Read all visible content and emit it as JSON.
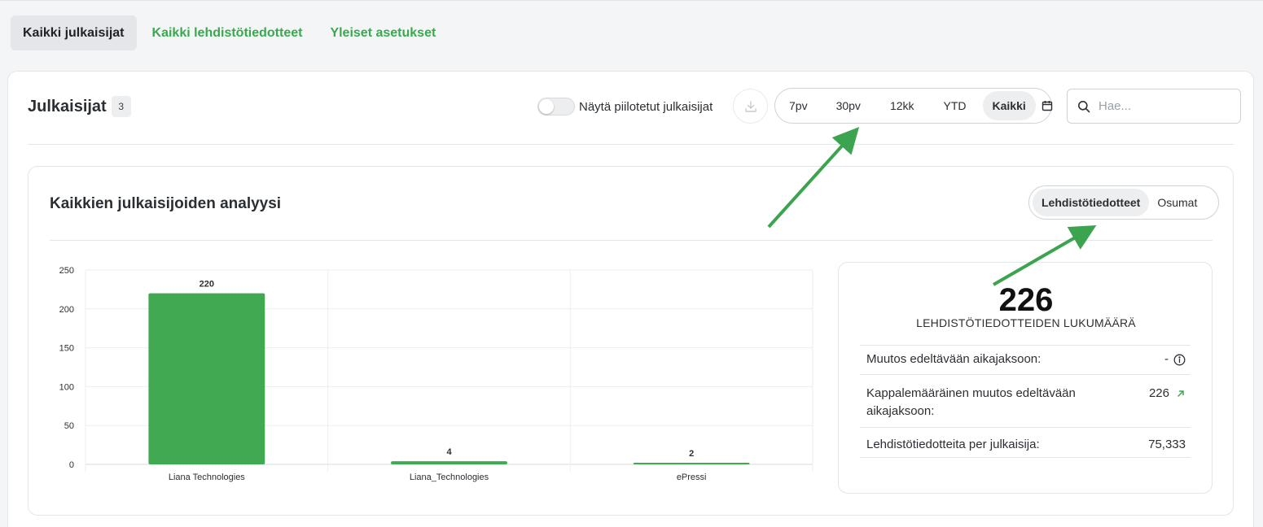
{
  "nav": {
    "tabs": [
      {
        "label": "Kaikki julkaisijat",
        "active": true
      },
      {
        "label": "Kaikki lehdistötiedotteet",
        "active": false
      },
      {
        "label": "Yleiset asetukset",
        "active": false
      }
    ]
  },
  "header": {
    "title": "Julkaisijat",
    "count": "3",
    "toggle_label": "Näytä piilotetut julkaisijat",
    "ranges": [
      {
        "label": "7pv",
        "active": false
      },
      {
        "label": "30pv",
        "active": false
      },
      {
        "label": "12kk",
        "active": false
      },
      {
        "label": "YTD",
        "active": false
      },
      {
        "label": "Kaikki",
        "active": true
      }
    ],
    "search_placeholder": "Hae..."
  },
  "analysis": {
    "title": "Kaikkien julkaisijoiden analyysi",
    "metric_tabs": [
      {
        "label": "Lehdistötiedotteet",
        "active": true
      },
      {
        "label": "Osumat",
        "active": false
      }
    ]
  },
  "chart_data": {
    "type": "bar",
    "categories": [
      "Liana Technologies",
      "Liana_Technologies",
      "ePressi"
    ],
    "values": [
      220,
      4,
      2
    ],
    "ylim": [
      0,
      250
    ],
    "yticks": [
      0,
      50,
      100,
      150,
      200,
      250
    ],
    "grid": true,
    "color": "#41a952"
  },
  "stats": {
    "total": "226",
    "total_label": "LEHDISTÖTIEDOTTEIDEN LUKUMÄÄRÄ",
    "rows": [
      {
        "label": "Muutos edeltävään aikajaksoon:",
        "value": "-"
      },
      {
        "label": "Kappalemääräinen muutos edeltävään aikajaksoon:",
        "value": "226"
      },
      {
        "label": "Lehdistötiedotteita per julkaisija:",
        "value": "75,333"
      }
    ]
  },
  "colors": {
    "accent": "#3ba84f",
    "bar": "#41a952",
    "annotation_arrow": "#3ca34f"
  }
}
